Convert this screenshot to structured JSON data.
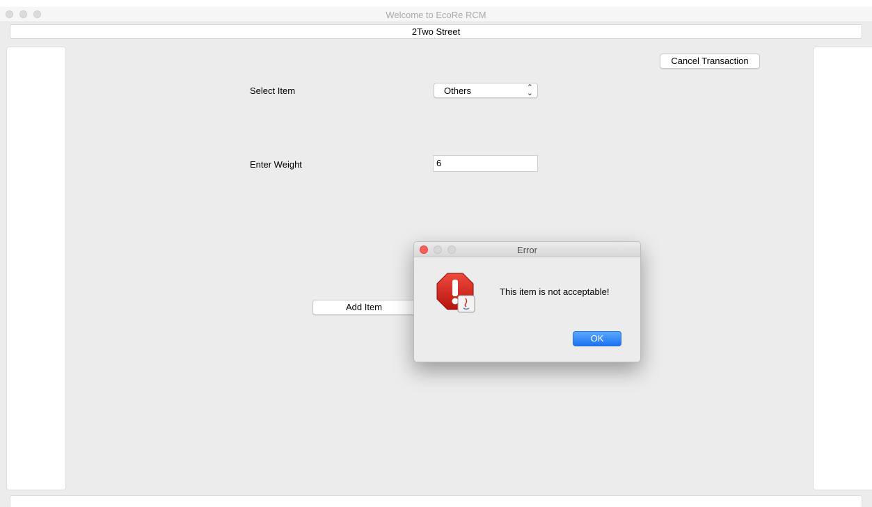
{
  "window": {
    "title": "Welcome to EcoRe RCM"
  },
  "header": {
    "street": "2Two Street"
  },
  "form": {
    "cancel_label": "Cancel Transaction",
    "select_item_label": "Select Item",
    "select_item_value": "Others",
    "enter_weight_label": "Enter Weight",
    "weight_value": "6",
    "add_item_label": "Add Item"
  },
  "dialog": {
    "title": "Error",
    "message": "This item is not acceptable!",
    "ok_label": "OK",
    "icon": "error-stop-icon"
  },
  "colors": {
    "ok_button": "#1b72f1",
    "error_icon": "#d9261c",
    "close_button": "#fc5f57"
  }
}
